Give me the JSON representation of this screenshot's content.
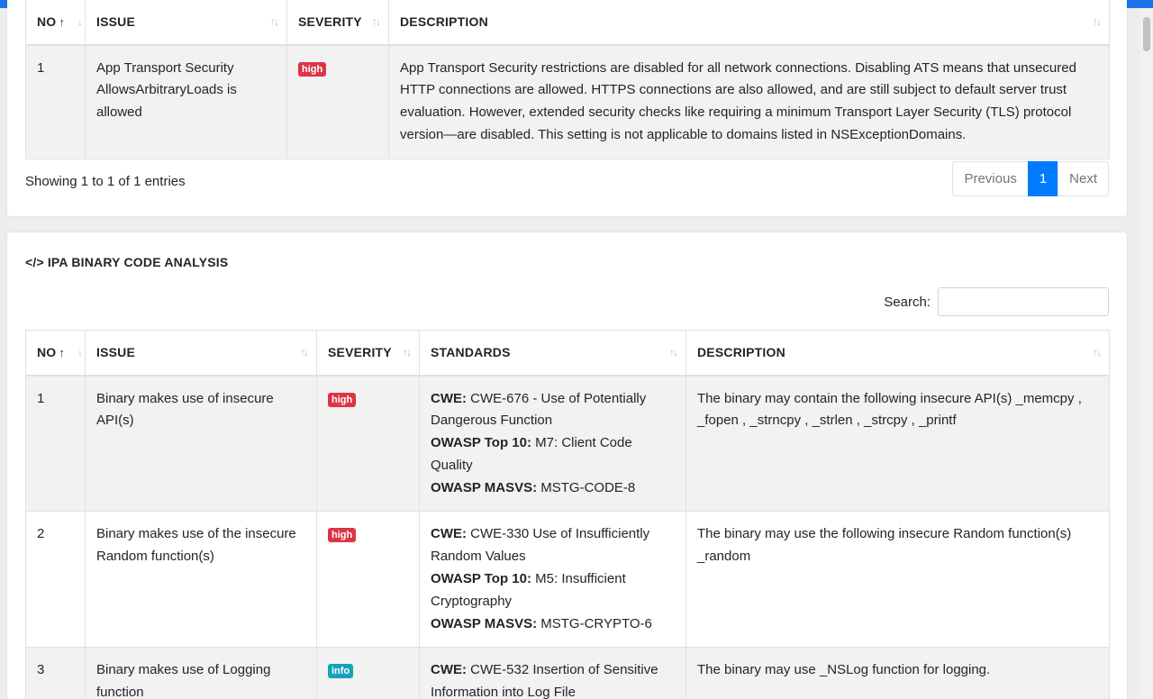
{
  "manifest_table": {
    "headers": [
      "NO",
      "ISSUE",
      "SEVERITY",
      "DESCRIPTION"
    ],
    "rows": [
      {
        "no": "1",
        "issue": "App Transport Security AllowsArbitraryLoads is allowed",
        "severity": "high",
        "description": "App Transport Security restrictions are disabled for all network connections. Disabling ATS means that unsecured HTTP connections are allowed. HTTPS connections are also allowed, and are still subject to default server trust evaluation. However, extended security checks like requiring a minimum Transport Layer Security (TLS) protocol version—are disabled. This setting is not applicable to domains listed in NSExceptionDomains."
      }
    ],
    "info": "Showing 1 to 1 of 1 entries",
    "pagination": {
      "previous": "Previous",
      "current": "1",
      "next": "Next"
    }
  },
  "binary_section": {
    "icon": "code-icon",
    "title": "IPA BINARY CODE ANALYSIS",
    "search_label": "Search:",
    "search_value": "",
    "headers": [
      "NO",
      "ISSUE",
      "SEVERITY",
      "STANDARDS",
      "DESCRIPTION"
    ],
    "rows": [
      {
        "no": "1",
        "issue": "Binary makes use of insecure API(s)",
        "severity": "high",
        "cwe_label": "CWE:",
        "cwe": "CWE-676 - Use of Potentially Dangerous Function",
        "owasp_label": "OWASP Top 10:",
        "owasp": "M7: Client Code Quality",
        "masvs_label": "OWASP MASVS:",
        "masvs": "MSTG-CODE-8",
        "description": "The binary may contain the following insecure API(s) _memcpy , _fopen , _strncpy , _strlen , _strcpy , _printf"
      },
      {
        "no": "2",
        "issue": "Binary makes use of the insecure Random function(s)",
        "severity": "high",
        "cwe_label": "CWE:",
        "cwe": "CWE-330 Use of Insufficiently Random Values",
        "owasp_label": "OWASP Top 10:",
        "owasp": "M5: Insufficient Cryptography",
        "masvs_label": "OWASP MASVS:",
        "masvs": "MSTG-CRYPTO-6",
        "description": "The binary may use the following insecure Random function(s) _random"
      },
      {
        "no": "3",
        "issue": "Binary makes use of Logging function",
        "severity": "info",
        "cwe_label": "CWE:",
        "cwe": "CWE-532 Insertion of Sensitive Information into Log File",
        "description": "The binary may use _NSLog function for logging."
      }
    ]
  },
  "colors": {
    "high": "#dc3545",
    "info": "#17a2b8",
    "accent": "#007bff",
    "topbar": "#1a73e8"
  }
}
